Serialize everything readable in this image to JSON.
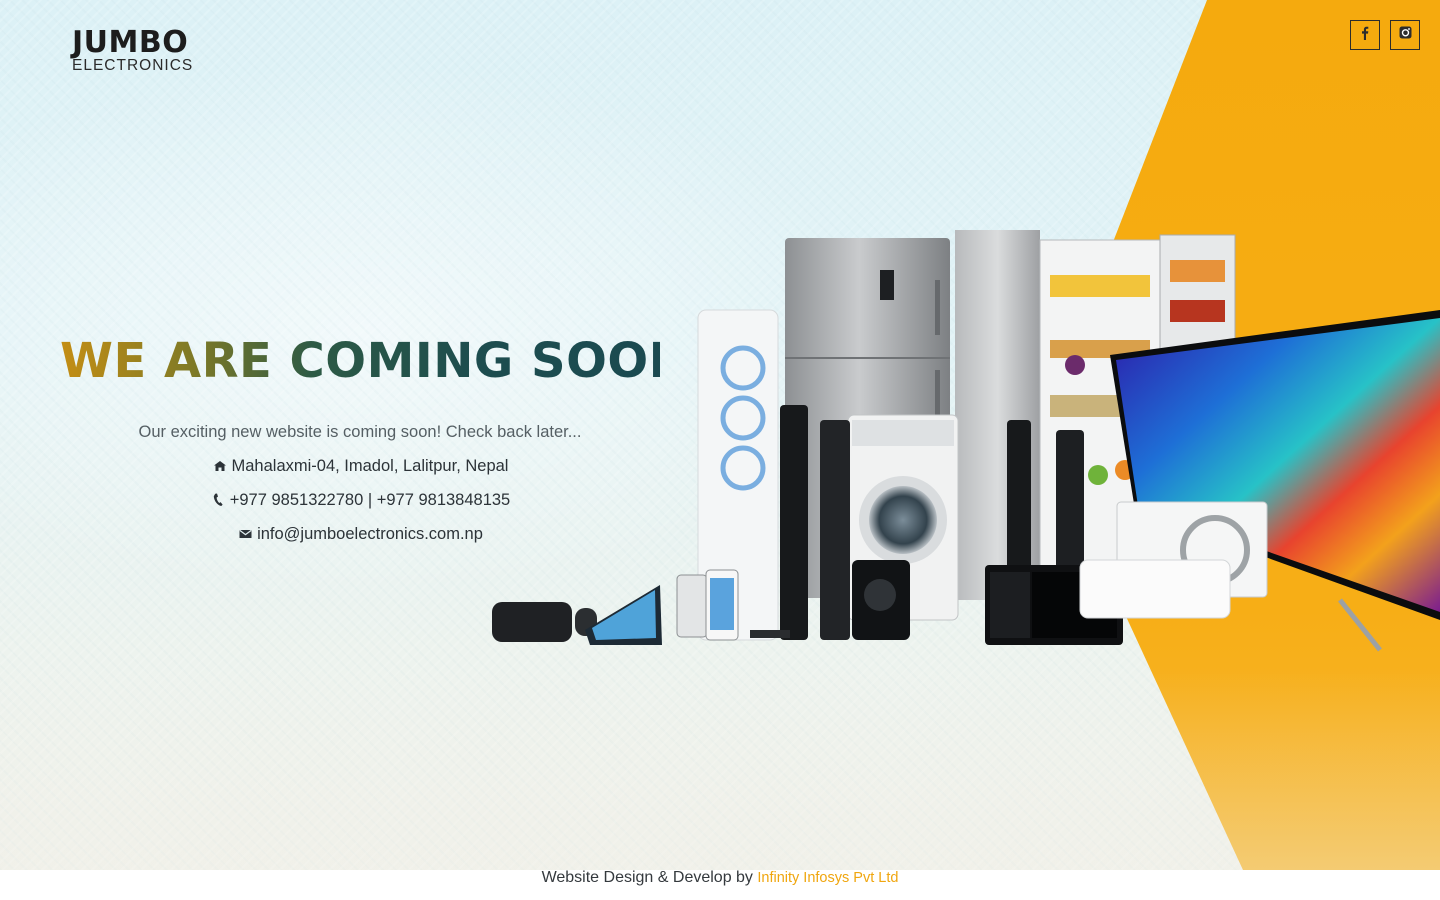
{
  "brand": {
    "name_top": "JUMBO",
    "name_bottom": "ELECTRONICS"
  },
  "socials": [
    {
      "name": "facebook",
      "icon": "facebook-icon"
    },
    {
      "name": "instagram",
      "icon": "instagram-icon"
    }
  ],
  "hero": {
    "headline": "WE ARE COMING SOON",
    "tagline": "Our exciting new website is coming soon! Check back later...",
    "address": "Mahalaxmi-04, Imadol, Lalitpur, Nepal",
    "phone": "+977 9851322780 | +977 9813848135",
    "email": "info@jumboelectronics.com.np",
    "address_icon": "home-icon",
    "phone_icon": "phone-icon",
    "email_icon": "envelope-icon"
  },
  "footer": {
    "text": "Website Design & Develop by ",
    "link_label": "Infinity Infosys Pvt Ltd"
  },
  "colors": {
    "accent_orange": "#f5aa0e",
    "headline_gold": "#c48e14",
    "headline_teal": "#1a4a50",
    "background_light": "#dcf1f6"
  }
}
